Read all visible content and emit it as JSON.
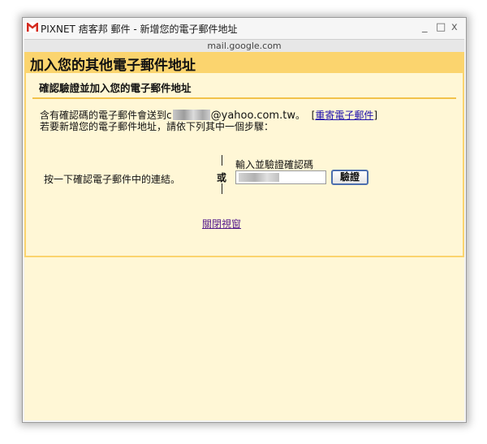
{
  "window": {
    "title": "PIXNET 痞客邦 郵件 - 新增您的電子郵件地址",
    "controls": {
      "minimize": "_",
      "maximize": "□",
      "close": "x"
    },
    "address": "mail.google.com"
  },
  "header": {
    "title": "加入您的其他電子郵件地址"
  },
  "panel": {
    "subtitle": "確認驗證並加入您的電子郵件地址",
    "sent_prefix": "含有確認碼的電子郵件會送到",
    "sent_first_char": "c",
    "email_domain": "@yahoo.com.tw",
    "sent_suffix": "。",
    "resend_link": "重寄電子郵件",
    "instruction": "若要新增您的電子郵件地址，請依下列其中一個步驟：",
    "method_click": "按一下確認電子郵件中的連結。",
    "or_text": "或",
    "code_label": "輸入並驗證確認碼",
    "verify_button": "驗證",
    "close_link": "關閉視窗"
  },
  "colors": {
    "header_bg": "#fbd46e",
    "content_bg": "#fff7d6",
    "link": "#1a0dab",
    "visited_link": "#551a8b"
  },
  "icons": {
    "app": "gmail-icon"
  }
}
